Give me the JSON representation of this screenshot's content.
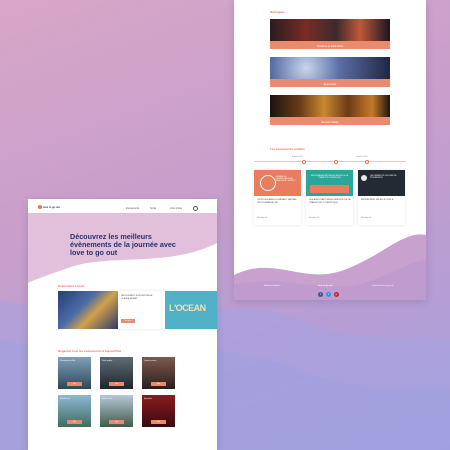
{
  "brand": {
    "logo_text": "love to go out",
    "accent": "#e8735c",
    "navy": "#27336b"
  },
  "right_page": {
    "section_title": "Rubriques",
    "banners": [
      {
        "label": "Tourisme et Patrimoine"
      },
      {
        "label": "Spectacles"
      },
      {
        "label": "Bonnes Tables"
      }
    ],
    "events_title": "Les événements publiés",
    "timeline": [
      "Aujourd'hui",
      "Demain",
      "Mardi 12/05"
    ],
    "cards": [
      {
        "img_text": "SEMAINE DE SENSIBILISATION AU HANDICAP A L'HERAULT",
        "title": "L'ÉTÉ DES AMIS DU HÉRAUT NATURE PHOTOGRAPHIQUE",
        "meta": "Monday 4th"
      },
      {
        "img_text": "DES ÉCHANGES MÉTIERS AU SERVICE DE LA TRANSITION TOURISTIQUE",
        "title": "LES ASSOCIATIONS AU SERVICE DE LA TRANSITION TOURISTIQUE",
        "meta": "Monday 4th"
      },
      {
        "img_text": "L'ACCESSIBILITÉ, UN LEVIER DE PROGRESSION",
        "title": "ENTREPRISE: ENJEU ET RÔLE",
        "meta": "Monday 4th"
      }
    ],
    "footer": {
      "left": "Mentions légales",
      "center": "love to go out",
      "right": "Contact love to go out"
    },
    "social": [
      {
        "icon": "facebook-icon",
        "glyph": "f",
        "color": "#3b5998"
      },
      {
        "icon": "twitter-icon",
        "glyph": "t",
        "color": "#1da1f2"
      },
      {
        "icon": "pinterest-icon",
        "glyph": "p",
        "color": "#cb2027"
      }
    ]
  },
  "left_page": {
    "nav": [
      "Evénements",
      "Sortie",
      "Vous inviter"
    ],
    "hero_title": "Découvrez les meilleurs évènements de la journée avec love to go out",
    "featured_title": "Évènement à venir",
    "featured_card": {
      "title": "DÉCOUVREZ L'EXPOSITION DE CLAUDE MONET",
      "button": "Voir plus"
    },
    "ocean_text": "L'OCEAN",
    "grid_title": "Regarder tous les évènements d'aujourd'hui",
    "grid_buttons": [
      "Voir",
      "Voir",
      "Voir",
      "Voir",
      "Voir",
      "Voir"
    ],
    "grid_captions": [
      "Promenade en Mer",
      "Visite guidée",
      "Quartier ancien",
      "Bord de mer",
      "Nature et lac",
      "Spectacle"
    ]
  }
}
